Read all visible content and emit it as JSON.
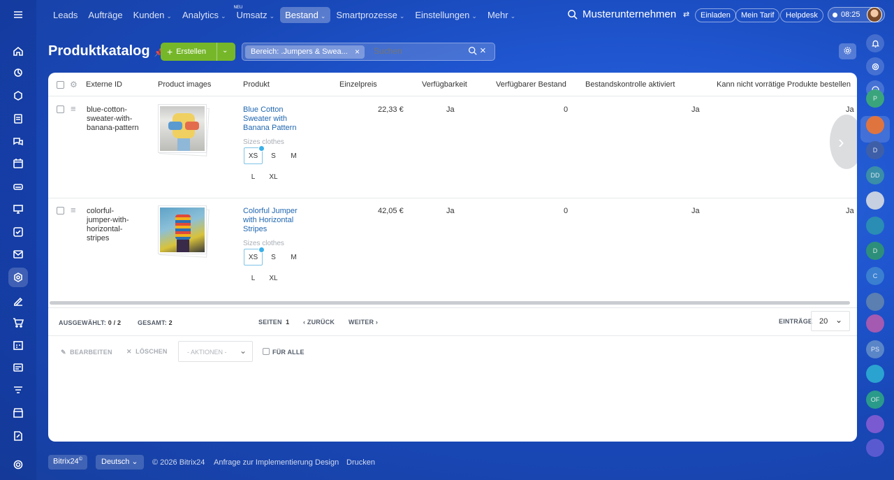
{
  "nav": {
    "items": [
      {
        "label": "Leads",
        "chevron": false
      },
      {
        "label": "Aufträge",
        "chevron": false
      },
      {
        "label": "Kunden",
        "chevron": true
      },
      {
        "label": "Analytics",
        "chevron": true
      },
      {
        "label": "Umsatz",
        "chevron": true,
        "badge": "NEU"
      },
      {
        "label": "Bestand",
        "chevron": true,
        "active": true
      },
      {
        "label": "Smartprozesse",
        "chevron": true
      },
      {
        "label": "Einstellungen",
        "chevron": true
      },
      {
        "label": "Mehr",
        "chevron": true
      }
    ],
    "company": "Musterunternehmen",
    "invite": "Einladen",
    "tariff": "Mein Tarif",
    "helpdesk": "Helpdesk",
    "time": "08:25"
  },
  "page": {
    "title": "Produktkatalog",
    "create_label": "Erstellen",
    "filter_chip": "Bereich: .Jumpers & Swea...",
    "search_placeholder": "Suchen"
  },
  "table": {
    "columns": [
      "Externe ID",
      "Product images",
      "Produkt",
      "Einzelpreis",
      "Verfügbarkeit",
      "Verfügbarer Bestand",
      "Bestandskontrolle aktiviert",
      "Kann nicht vorrätige Produkte bestellen"
    ],
    "sizes_label": "Sizes clothes",
    "sizes": [
      "XS",
      "S",
      "M",
      "L",
      "XL"
    ],
    "rows": [
      {
        "id_lines": [
          "blue-cotton-",
          "sweater-with-",
          "banana-pattern"
        ],
        "name_lines": [
          "Blue Cotton",
          "Sweater with",
          "Banana Pattern"
        ],
        "price": "22,33 €",
        "availability": "Ja",
        "stock": "0",
        "control": "Ja",
        "order": "Ja"
      },
      {
        "id_lines": [
          "colorful-",
          "jumper-with-",
          "horizontal-",
          "stripes"
        ],
        "name_lines": [
          "Colorful Jumper",
          "with Horizontal",
          "Stripes"
        ],
        "price": "42,05 €",
        "availability": "Ja",
        "stock": "0",
        "control": "Ja",
        "order": "Ja"
      }
    ]
  },
  "pager": {
    "selected_label": "AUSGEWÄHLT:",
    "selected_value": "0 / 2",
    "total_label": "GESAMT:",
    "total_value": "2",
    "pages_label": "SEITEN",
    "page": "1",
    "back": "ZURÜCK",
    "next": "WEITER",
    "entries_label": "EINTRÄGE",
    "entries_value": "20"
  },
  "actions": {
    "edit": "BEARBEITEN",
    "delete": "LÖSCHEN",
    "select": "- AKTIONEN -",
    "for_all": "FÜR ALLE"
  },
  "footer": {
    "brand": "Bitrix24",
    "lang": "Deutsch",
    "copyright": "© 2026 Bitrix24",
    "impl": "Anfrage zur Implementierung",
    "design": "Design",
    "print": "Drucken"
  },
  "right_rail": [
    "P",
    "",
    "D",
    "DD",
    "",
    "",
    "D",
    "C",
    "",
    "",
    "PS",
    "",
    "OF",
    "",
    ""
  ],
  "colors": {
    "accent": "#2067b0",
    "create": "#76b72a",
    "bg": "#1f55cf"
  }
}
